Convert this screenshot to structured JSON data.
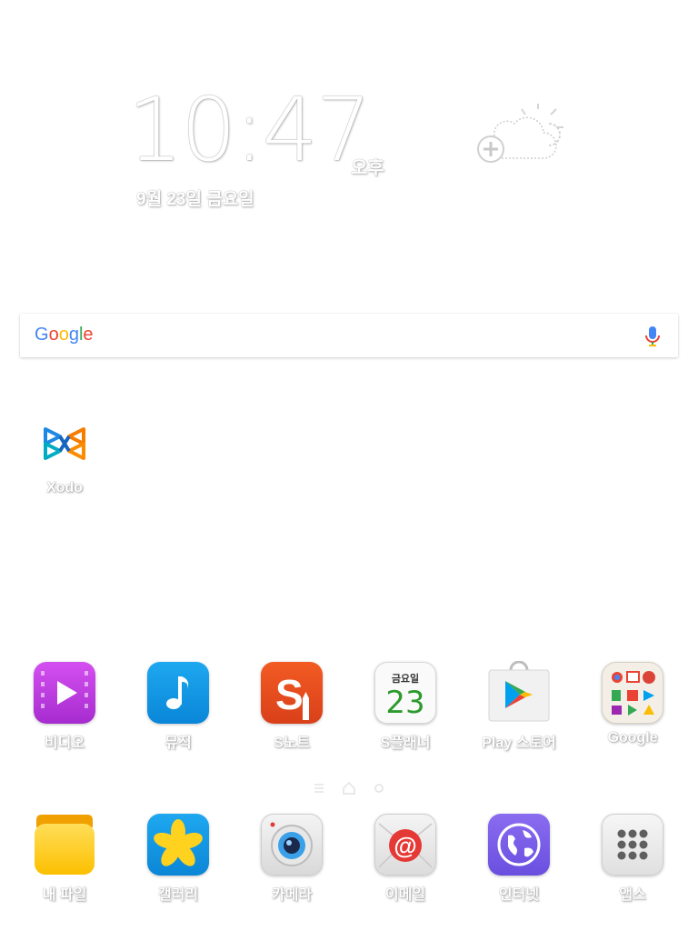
{
  "clock": {
    "time": "10:47",
    "ampm": "오후",
    "date": "9월 23일 금요일"
  },
  "search": {
    "logo_letters": [
      "G",
      "o",
      "o",
      "g",
      "l",
      "e"
    ]
  },
  "desktop": {
    "xodo_label": "Xodo"
  },
  "dock_row1": [
    {
      "label": "비디오"
    },
    {
      "label": "뮤직"
    },
    {
      "label": "S노트"
    },
    {
      "label": "S플래너",
      "cal_day": "금요일",
      "cal_num": "23"
    },
    {
      "label": "Play 스토어"
    },
    {
      "label": "Google"
    }
  ],
  "dock_row2": [
    {
      "label": "내 파일"
    },
    {
      "label": "갤러리"
    },
    {
      "label": "카메라"
    },
    {
      "label": "이메일"
    },
    {
      "label": "인터넷"
    },
    {
      "label": "앱스"
    }
  ],
  "colors": {
    "google_blue": "#4285F4",
    "google_red": "#EA4335",
    "google_yellow": "#FBBC05",
    "google_green": "#34A853"
  }
}
